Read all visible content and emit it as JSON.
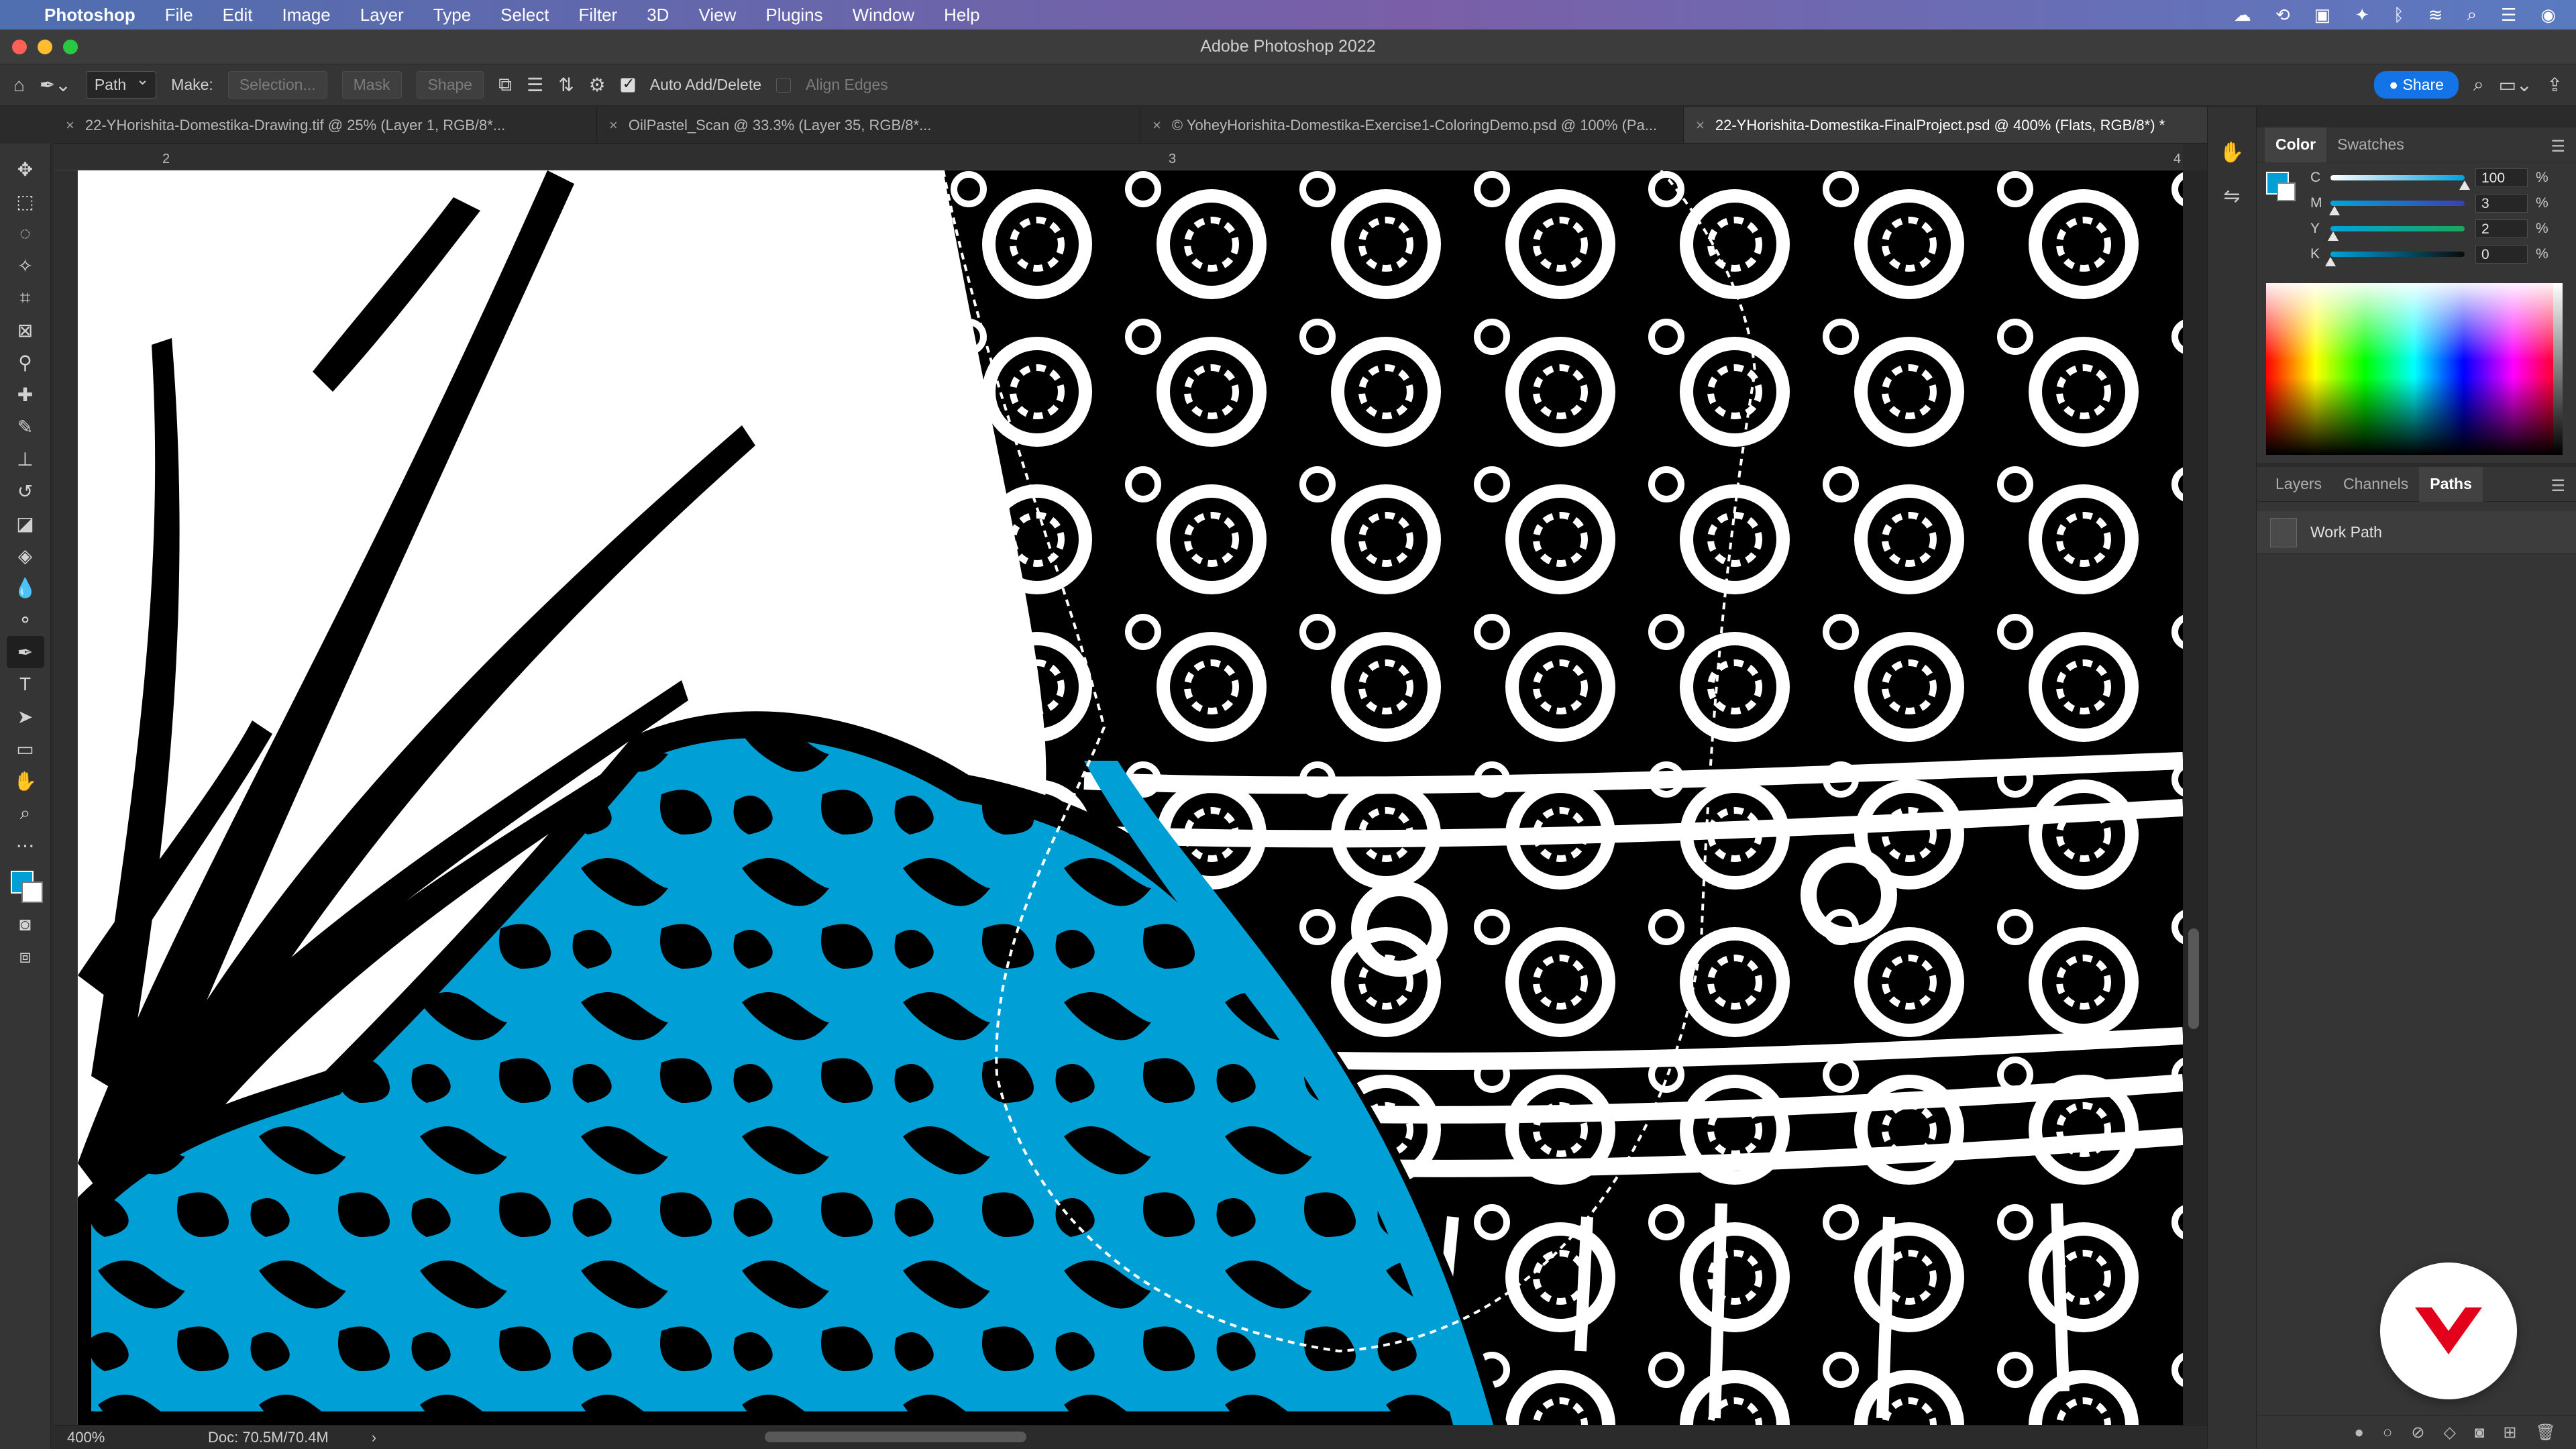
{
  "menubar": {
    "apple": "",
    "app_name": "Photoshop",
    "items": [
      "File",
      "Edit",
      "Image",
      "Layer",
      "Type",
      "Select",
      "Filter",
      "3D",
      "View",
      "Plugins",
      "Window",
      "Help"
    ],
    "right_icons": [
      "creative-cloud-icon",
      "cc-sync-icon",
      "screen-share-icon",
      "extension-icon",
      "bluetooth-icon",
      "wifi-icon",
      "search-icon",
      "control-center-icon",
      "siri-icon"
    ]
  },
  "window": {
    "title": "Adobe Photoshop 2022"
  },
  "options": {
    "mode_value": "Path",
    "make_label": "Make:",
    "selection_button": "Selection...",
    "mask_button": "Mask",
    "shape_button": "Shape",
    "auto_add_label": "Auto Add/Delete",
    "align_edges_label": "Align Edges",
    "share_label": "Share"
  },
  "tabs": [
    {
      "label": "22-YHorishita-Domestika-Drawing.tif @ 25% (Layer 1, RGB/8*...",
      "active": false
    },
    {
      "label": "OilPastel_Scan @ 33.3% (Layer 35, RGB/8*...",
      "active": false
    },
    {
      "label": "© YoheyHorishita-Domestika-Exercise1-ColoringDemo.psd @ 100% (Pa...",
      "active": false
    },
    {
      "label": "22-YHorishita-Domestika-FinalProject.psd @ 400% (Flats, RGB/8*) *",
      "active": true
    }
  ],
  "ruler": {
    "marks": [
      "2",
      "3",
      "4"
    ]
  },
  "status": {
    "zoom": "400%",
    "doc": "Doc: 70.5M/70.4M",
    "arrow": "›"
  },
  "color_panel": {
    "tabs": [
      "Color",
      "Swatches"
    ],
    "active_tab": "Color",
    "fg_color": "#00a0d6",
    "rows": [
      {
        "label": "C",
        "value": "100",
        "unit": "%",
        "level": 100,
        "track": "linear-gradient(90deg,#ffffff,#00a0e0)"
      },
      {
        "label": "M",
        "value": "3",
        "unit": "%",
        "level": 3,
        "track": "linear-gradient(90deg,#00a4dc,#3b3fb0)"
      },
      {
        "label": "Y",
        "value": "2",
        "unit": "%",
        "level": 2,
        "track": "linear-gradient(90deg,#00a4dc,#1aa85a)"
      },
      {
        "label": "K",
        "value": "0",
        "unit": "%",
        "level": 0,
        "track": "linear-gradient(90deg,#00a4dc,#0a0a0a)"
      }
    ]
  },
  "paths_panel": {
    "tabs": [
      "Layers",
      "Channels",
      "Paths"
    ],
    "active_tab": "Paths",
    "rows": [
      {
        "label": "Work Path"
      }
    ]
  },
  "colors": {
    "accent": "#1473e6",
    "cyan_fill": "#00a0d6",
    "logo_red": "#e2001a"
  }
}
